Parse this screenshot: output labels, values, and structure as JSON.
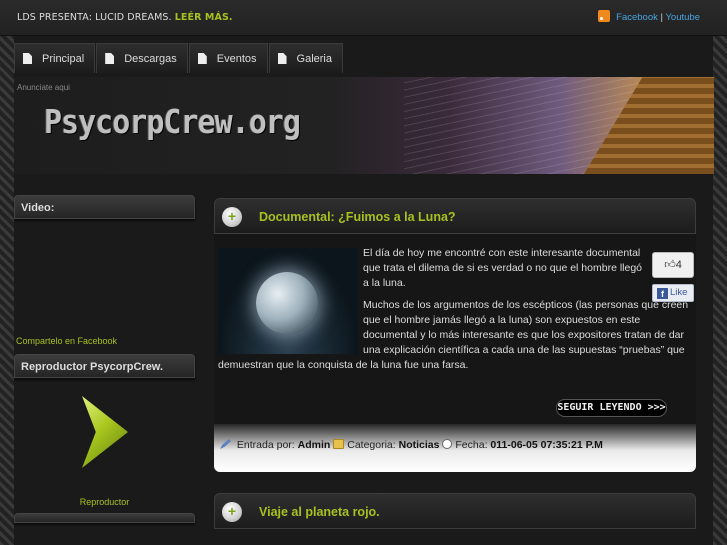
{
  "topbar": {
    "announce": "LDS PRESENTA: LUCID DREAMS.",
    "read_more": "LEÉR MÁS.",
    "social_facebook": "Facebook",
    "social_separator": "|",
    "social_youtube": "Youtube"
  },
  "nav": {
    "items": [
      {
        "label": "Principal"
      },
      {
        "label": "Descargas"
      },
      {
        "label": "Eventos"
      },
      {
        "label": "Galeria"
      }
    ]
  },
  "banner": {
    "ad_text": "Anunciate aqui",
    "logo_text": "PsycorpCrew.org"
  },
  "sidebar": {
    "video_title": "Video:",
    "share_link": "Compartelo en Facebook",
    "player_title": "Reproductor PsycorpCrew.",
    "player_label": "Reproductor"
  },
  "posts": [
    {
      "title": "Documental: ¿Fuimos a la Luna?",
      "paragraph1": "El día de hoy me encontré con este interesante documental que trata el dilema de si es verdad o no que el hombre llegó a la luna.",
      "paragraph2": "Muchos de los argumentos de los escépticos (las personas que creen que el hombre jamás llegó a la luna) son expuestos en este documental y lo más interesante es que los expositores tratan de dar una explicación científica a cada una de las supuestas “pruebas” que demuestran que la conquista de la luna fue una farsa.",
      "like_count": "4",
      "like_label": "Like",
      "read_more": "SEGUIR LEYENDO >>>",
      "meta": {
        "author_label": "Entrada por:",
        "author": "Admin",
        "category_label": "Categoria:",
        "category": "Noticias",
        "date_label": "Fecha:",
        "date": "011-06-05 07:35:21 P.M"
      }
    },
    {
      "title": "Viaje al planeta rojo."
    }
  ],
  "colors": {
    "accent": "#a6c21f",
    "link": "#4aa3df",
    "background": "#1a1a1a"
  }
}
